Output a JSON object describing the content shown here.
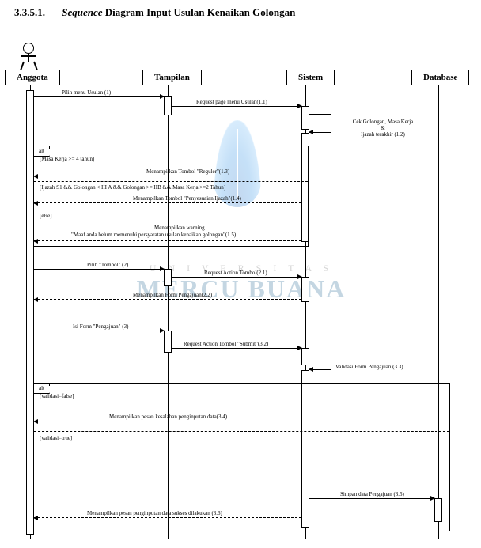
{
  "title": {
    "number": "3.3.5.1.",
    "sequence_word": "Sequence",
    "rest": "Diagram Input Usulan Kenaikan Golongan"
  },
  "lifelines": {
    "anggota": "Anggota",
    "tampilan": "Tampilan",
    "sistem": "Sistem",
    "database": "Database"
  },
  "messages": {
    "m1": "Pilih menu Usulan (1)",
    "m1_1": "Request page menu Usulan(1.1)",
    "m1_2a": "Cek Golongan, Masa Kerja",
    "m1_2b": "&",
    "m1_2c": "Ijazah terakhir (1.2)",
    "guard1": "[Masa Kerja >= 4 tahun]",
    "m1_3": "Menampilkan Tombol \"Reguler\"(1.3)",
    "guard2": "[Ijazah S1 && Golongan < III A && Golongan >= IIB && Masa Kerja >=2 Tahun]",
    "m1_4": "Menampilkan Tombol \"Penyesuaian Ijazah\"(1.4)",
    "guard3": "[else]",
    "m1_5a": "Menampilkan warning",
    "m1_5b": "\"Maaf anda belum memenuhi persyaratan usulan kenaikan golongan\"(1.5)",
    "m2": "Pilih \"Tombol\" (2)",
    "m2_1": "Request Action Tombol(2.1)",
    "m2_2": "Menampilkan Form Pengajuan(2.2)",
    "m3": "Isi Form \"Pengajuan\" (3)",
    "m3_2": "Request Action Tombol \"Submit\"(3.2)",
    "m3_3": "Validasi Form Pengajuan (3.3)",
    "guard4": "[validasi=false]",
    "m3_4": "Menampilkan pesan kesalahan penginputan data(3.4)",
    "guard5": "[validasi=true]",
    "m3_5": "Simpan data Pengajuan (3.5)",
    "m3_6": "Menampilkan pesan penginputan data sukses dilakukan (3.6)"
  },
  "alt_label": "alt",
  "watermark": {
    "uni": "U N I V E R S I T A S",
    "mb": "MERCU BUANA"
  }
}
